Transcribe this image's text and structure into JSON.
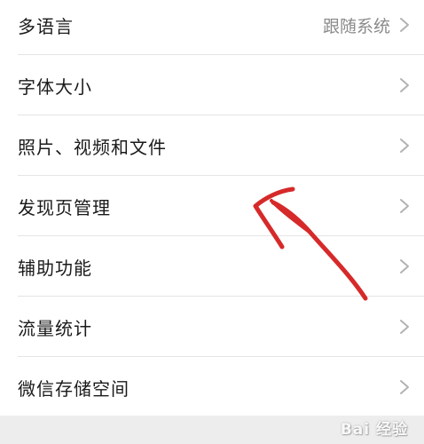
{
  "settings": {
    "items": [
      {
        "label": "多语言",
        "value": "跟随系统"
      },
      {
        "label": "字体大小",
        "value": ""
      },
      {
        "label": "照片、视频和文件",
        "value": ""
      },
      {
        "label": "发现页管理",
        "value": ""
      },
      {
        "label": "辅助功能",
        "value": ""
      },
      {
        "label": "流量统计",
        "value": ""
      },
      {
        "label": "微信存储空间",
        "value": ""
      }
    ]
  },
  "watermark": {
    "text": "Bai 经验"
  },
  "colors": {
    "annotation_arrow": "#d62a2a",
    "text_primary": "#1a1a1a",
    "text_secondary": "#8a8a8a",
    "chevron": "#b2b2b2",
    "divider": "#e4e4e4",
    "footer_bg": "#ededed"
  },
  "icons": {
    "row_chevron": "chevron-right-icon",
    "annotation": "hand-drawn-arrow-icon"
  }
}
